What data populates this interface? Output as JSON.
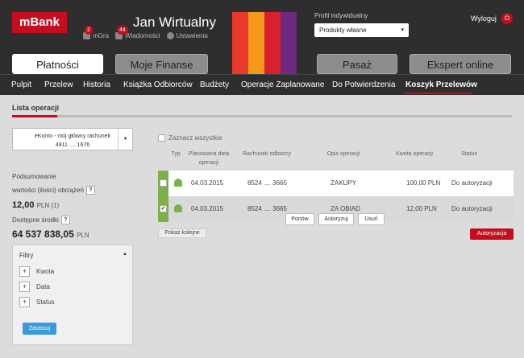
{
  "header": {
    "logo": "mBank",
    "user_name": "Jan Wirtualny",
    "mini_links": [
      {
        "label": "mGra",
        "badge": "2"
      },
      {
        "label": "Wiadomości",
        "badge": "44"
      },
      {
        "label": "Ustawienia",
        "badge": ""
      }
    ],
    "profile_label": "Profil indywidualny",
    "profile_value": "Produkty własne",
    "logout": "Wyloguj",
    "stripe_colors": [
      "#e8392c",
      "#f39a1b",
      "#d8202e",
      "#6b2a7d"
    ],
    "big_buttons": [
      "Płatności",
      "Moje Finanse",
      "Pasaż",
      "Ekspert online"
    ]
  },
  "nav": {
    "items": [
      "Pulpit",
      "Przelew",
      "Historia",
      "Książka Odbiorców",
      "Budżety",
      "Operacje Zaplanowane",
      "Do Potwierdzenia",
      "Koszyk Przelewów"
    ],
    "active": "Koszyk Przelewów"
  },
  "page": {
    "title": "Lista operacji"
  },
  "account": {
    "name": "eKonto - mój główny rachunek",
    "number": "4911 .... 1676"
  },
  "summary": {
    "label1": "Podsumowanie",
    "label2": "wartości (ilości) obciążeń",
    "help": "?",
    "value": "12,00",
    "value_suffix": "PLN (1)",
    "available_label": "Dostępne środki",
    "available_value": "64 537 838,05",
    "available_currency": "PLN"
  },
  "filters": {
    "title": "Filtry",
    "items": [
      "Kwota",
      "Data",
      "Status"
    ],
    "apply": "Zastosuj"
  },
  "table": {
    "select_all": "Zaznacz wszystkie",
    "headers": [
      "Typ",
      "Planowana data operacji",
      "Rachunek odbiorcy",
      "Opis operacji",
      "Kwota operacji",
      "Status"
    ],
    "rows": [
      {
        "checked": false,
        "date": "04.03.2015",
        "account": "8524 .... 3665",
        "desc": "ZAKUPY",
        "amount": "100,00 PLN",
        "status": "Do autoryzacji"
      },
      {
        "checked": true,
        "date": "04.03.2015",
        "account": "8524 .... 3665",
        "desc": "ZA OBIAD",
        "amount": "12,00 PLN",
        "status": "Do autoryzacji"
      }
    ],
    "row_actions": [
      "Ponów",
      "Autoryzuj",
      "Usuń"
    ],
    "show_more": "Pokaż kolejne",
    "authorize": "Autoryzacja"
  },
  "colors": {
    "brand_red": "#c40d1e",
    "green": "#7bb248",
    "apply_blue": "#3a9ad9"
  }
}
